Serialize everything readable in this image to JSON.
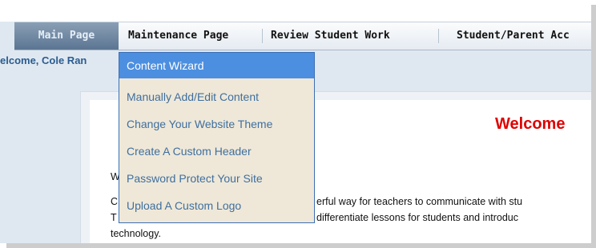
{
  "nav": {
    "tabs": [
      {
        "label": "Main Page",
        "active": true
      },
      {
        "label": "Maintenance Page",
        "active": false
      },
      {
        "label": "Review Student Work",
        "active": false
      },
      {
        "label": "Student/Parent Acc",
        "active": false
      }
    ]
  },
  "welcome_line": "elcome, Cole Ran",
  "dropdown": {
    "items": [
      {
        "label": "Content Wizard",
        "selected": true
      },
      {
        "label": "Manually Add/Edit Content"
      },
      {
        "label": "Change Your Website Theme"
      },
      {
        "label": "Create A Custom Header"
      },
      {
        "label": "Password Protect Your Site"
      },
      {
        "label": "Upload A Custom Logo"
      }
    ]
  },
  "content": {
    "heading": "Welcome",
    "line_w": "W",
    "para1_left": "C",
    "para1_right": "erful way for teachers to communicate with stu",
    "para2_left": "T",
    "para2_right": "differentiate lessons for students and introduc",
    "para3": "technology."
  },
  "colors": {
    "heading": "#e00000",
    "menu_selected": "#4c8fe0",
    "menu_bg": "#efe8d8",
    "menu_text": "#3f6f9f",
    "nav_active": "#5b7592"
  }
}
